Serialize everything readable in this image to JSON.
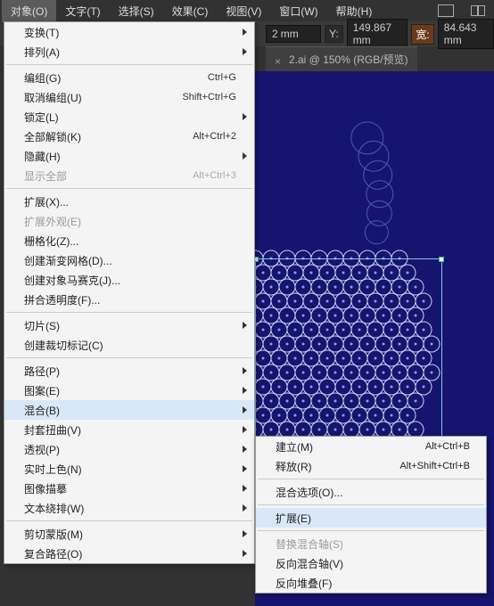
{
  "menubar": {
    "items": [
      "对象(O)",
      "文字(T)",
      "选择(S)",
      "效果(C)",
      "视图(V)",
      "窗口(W)",
      "帮助(H)"
    ]
  },
  "coords": {
    "y_label": "Y:",
    "y_value": "149.867",
    "y_unit": "mm",
    "w_label": "宽:",
    "w_value": "84.643",
    "w_unit": "mm",
    "left_unit": "mm",
    "left_tail": "2"
  },
  "tab": {
    "name": "2.ai @ 150% (RGB/预览)"
  },
  "menu": [
    {
      "t": "row",
      "label": "变换(T)",
      "sub": true
    },
    {
      "t": "row",
      "label": "排列(A)",
      "sub": true
    },
    {
      "t": "sep"
    },
    {
      "t": "row",
      "label": "编组(G)",
      "sc": "Ctrl+G"
    },
    {
      "t": "row",
      "label": "取消编组(U)",
      "sc": "Shift+Ctrl+G"
    },
    {
      "t": "row",
      "label": "锁定(L)",
      "sub": true
    },
    {
      "t": "row",
      "label": "全部解锁(K)",
      "sc": "Alt+Ctrl+2"
    },
    {
      "t": "row",
      "label": "隐藏(H)",
      "sub": true
    },
    {
      "t": "row",
      "label": "显示全部",
      "sc": "Alt+Ctrl+3",
      "dis": true
    },
    {
      "t": "sep"
    },
    {
      "t": "row",
      "label": "扩展(X)..."
    },
    {
      "t": "row",
      "label": "扩展外观(E)",
      "dis": true
    },
    {
      "t": "row",
      "label": "栅格化(Z)..."
    },
    {
      "t": "row",
      "label": "创建渐变网格(D)..."
    },
    {
      "t": "row",
      "label": "创建对象马赛克(J)..."
    },
    {
      "t": "row",
      "label": "拼合透明度(F)..."
    },
    {
      "t": "sep"
    },
    {
      "t": "row",
      "label": "切片(S)",
      "sub": true
    },
    {
      "t": "row",
      "label": "创建裁切标记(C)"
    },
    {
      "t": "sep"
    },
    {
      "t": "row",
      "label": "路径(P)",
      "sub": true
    },
    {
      "t": "row",
      "label": "图案(E)",
      "sub": true
    },
    {
      "t": "row",
      "label": "混合(B)",
      "sub": true,
      "hl": true
    },
    {
      "t": "row",
      "label": "封套扭曲(V)",
      "sub": true
    },
    {
      "t": "row",
      "label": "透视(P)",
      "sub": true
    },
    {
      "t": "row",
      "label": "实时上色(N)",
      "sub": true
    },
    {
      "t": "row",
      "label": "图像描摹",
      "sub": true
    },
    {
      "t": "row",
      "label": "文本绕排(W)",
      "sub": true
    },
    {
      "t": "sep"
    },
    {
      "t": "row",
      "label": "剪切蒙版(M)",
      "sub": true
    },
    {
      "t": "row",
      "label": "复合路径(O)",
      "sub": true
    }
  ],
  "submenu": [
    {
      "t": "row",
      "label": "建立(M)",
      "sc": "Alt+Ctrl+B"
    },
    {
      "t": "row",
      "label": "释放(R)",
      "sc": "Alt+Shift+Ctrl+B"
    },
    {
      "t": "sep"
    },
    {
      "t": "row",
      "label": "混合选项(O)..."
    },
    {
      "t": "sep"
    },
    {
      "t": "row",
      "label": "扩展(E)",
      "hl": true
    },
    {
      "t": "sep"
    },
    {
      "t": "row",
      "label": "替换混合轴(S)",
      "dis": true
    },
    {
      "t": "row",
      "label": "反向混合轴(V)"
    },
    {
      "t": "row",
      "label": "反向堆叠(F)"
    }
  ]
}
